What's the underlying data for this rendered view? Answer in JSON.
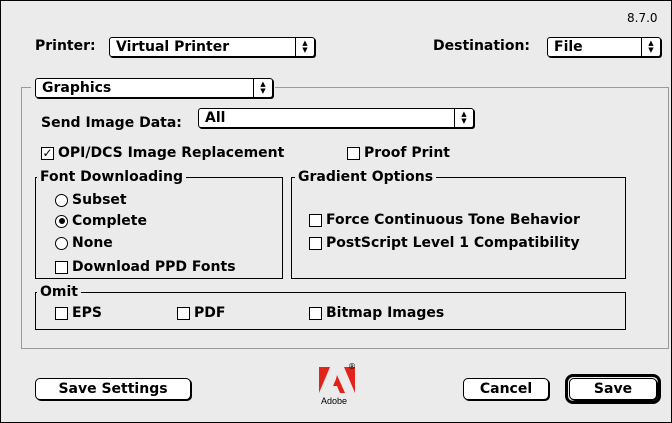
{
  "version": "8.7.0",
  "printer": {
    "label": "Printer:",
    "value": "Virtual Printer"
  },
  "destination": {
    "label": "Destination:",
    "value": "File"
  },
  "panel_selector": {
    "value": "Graphics"
  },
  "send_image_data": {
    "label": "Send Image Data:",
    "value": "All"
  },
  "opi_dcs": {
    "label": "OPI/DCS Image Replacement",
    "checked": true,
    "mark": "✓"
  },
  "proof_print": {
    "label": "Proof Print",
    "checked": false
  },
  "font_downloading": {
    "title": "Font Downloading",
    "options": [
      {
        "label": "Subset",
        "selected": false
      },
      {
        "label": "Complete",
        "selected": true
      },
      {
        "label": "None",
        "selected": false
      }
    ],
    "download_ppd": {
      "label": "Download PPD Fonts",
      "checked": false
    }
  },
  "gradient_options": {
    "title": "Gradient Options",
    "force_continuous": {
      "label": "Force Continuous Tone Behavior",
      "checked": false
    },
    "ps_level1": {
      "label": "PostScript Level 1 Compatibility",
      "checked": false
    }
  },
  "omit": {
    "title": "Omit",
    "eps": {
      "label": "EPS",
      "checked": false
    },
    "pdf": {
      "label": "PDF",
      "checked": false
    },
    "bitmap": {
      "label": "Bitmap Images",
      "checked": false
    }
  },
  "buttons": {
    "save_settings": "Save Settings",
    "cancel": "Cancel",
    "save": "Save"
  },
  "logo": {
    "text": "Adobe",
    "registered": "®",
    "color": "#e2231a"
  }
}
